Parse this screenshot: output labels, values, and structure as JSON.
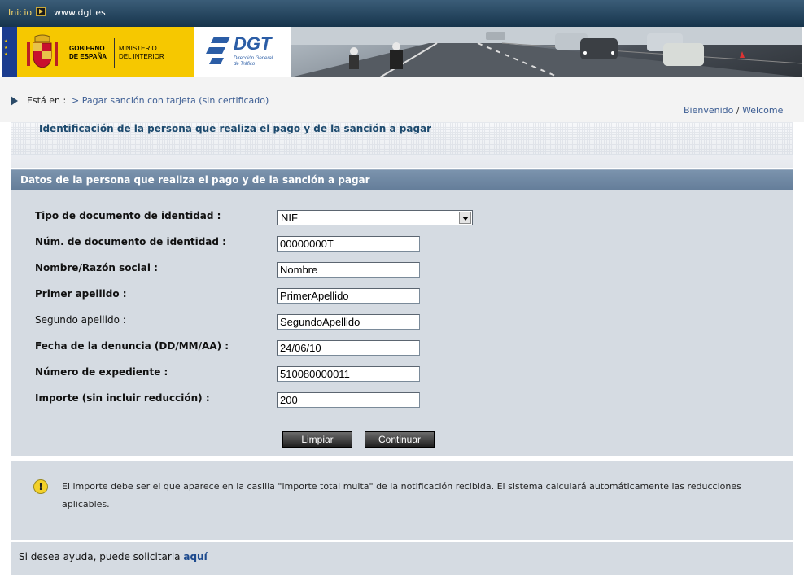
{
  "topbar": {
    "inicio": "Inicio",
    "site": "www.dgt.es"
  },
  "banner": {
    "gov_line1": "GOBIERNO",
    "gov_line2": "DE ESPAÑA",
    "min_line1": "MINISTERIO",
    "min_line2": "DEL INTERIOR",
    "dgt_name": "DGT",
    "dgt_sub1": "Dirección General",
    "dgt_sub2": "de Tráfico"
  },
  "breadcrumb": {
    "label": "Está en :",
    "link": "> Pagar sanción con tarjeta (sin certificado)"
  },
  "welcome": {
    "es": "Bienvenido",
    "sep": " / ",
    "en": "Welcome"
  },
  "page_title": "Identificación de la persona que realiza el pago y de la sanción a pagar",
  "section_title": "Datos de la persona que realiza el pago y de la sanción a pagar",
  "form": {
    "doc_type_label": "Tipo de documento de identidad :",
    "doc_type_value": "NIF",
    "doc_num_label": "Núm. de documento de identidad :",
    "doc_num_value": "00000000T",
    "name_label": "Nombre/Razón social :",
    "name_value": "Nombre",
    "surname1_label": "Primer apellido :",
    "surname1_value": "PrimerApellido",
    "surname2_label": "Segundo apellido :",
    "surname2_value": "SegundoApellido",
    "date_label": "Fecha de la denuncia (DD/MM/AA) :",
    "date_value": "24/06/10",
    "file_label": "Número de expediente :",
    "file_value": "510080000011",
    "amount_label": "Importe (sin incluir reducción) :",
    "amount_value": "200"
  },
  "buttons": {
    "clear": "Limpiar",
    "continue": "Continuar"
  },
  "note": {
    "icon": "warning-icon",
    "text": "El importe debe ser el que aparece en la casilla \"importe total multa\" de la notificación recibida. El sistema calculará automáticamente las reducciones aplicables."
  },
  "help": {
    "text": "Si desea ayuda, puede solicitarla ",
    "link": "aquí"
  }
}
